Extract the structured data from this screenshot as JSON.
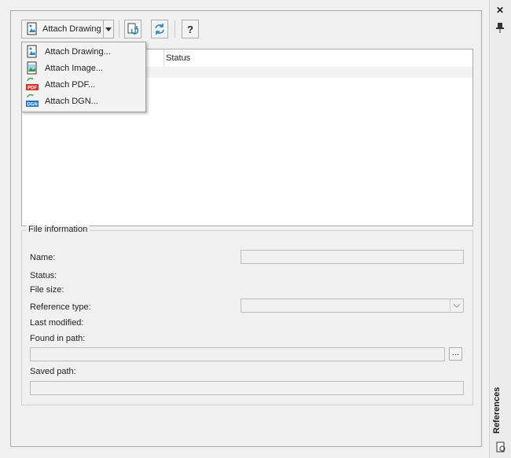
{
  "toolbar": {
    "attach_label": "Attach Drawing",
    "refresh_icon": "refresh-icon",
    "reload_icon": "reload-icon",
    "help_label": "?"
  },
  "menu": {
    "items": [
      {
        "label": "Attach Drawing...",
        "icon": "drawing-icon"
      },
      {
        "label": "Attach Image...",
        "icon": "image-icon"
      },
      {
        "label": "Attach PDF...",
        "icon": "pdf-icon",
        "badge": "PDF"
      },
      {
        "label": "Attach DGN...",
        "icon": "dgn-icon",
        "badge": "DGN"
      }
    ]
  },
  "list": {
    "columns": [
      "Status"
    ]
  },
  "file_info": {
    "legend": "File information",
    "name_label": "Name:",
    "status_label": "Status:",
    "size_label": "File size:",
    "reftype_label": "Reference type:",
    "modified_label": "Last modified:",
    "found_label": "Found in path:",
    "browse_label": "...",
    "saved_label": "Saved path:"
  },
  "side": {
    "close": "✕",
    "title": "References"
  },
  "colors": {
    "accent": "#1e88c8",
    "pdf_red": "#d0312d",
    "dgn_blue": "#1e78c8"
  }
}
